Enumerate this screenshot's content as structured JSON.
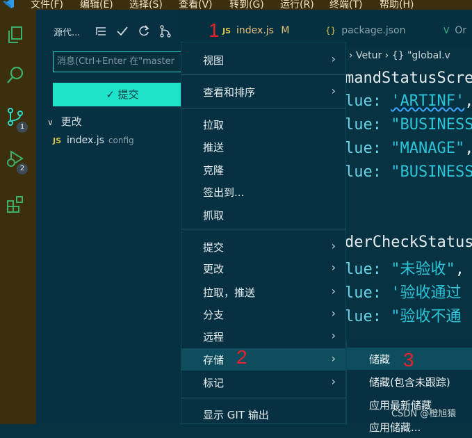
{
  "menubar": [
    "文件(F)",
    "编辑(E)",
    "选择(S)",
    "查看(V)",
    "转到(G)",
    "运行(R)",
    "终端(T)",
    "帮助(H)"
  ],
  "activity": {
    "scm_badge": "1",
    "debug_badge": "2"
  },
  "sidebar": {
    "title": "源代...",
    "more": "···",
    "message_placeholder": "消息(Ctrl+Enter 在\"master",
    "commit_label": "✓ 提交",
    "changes_label": "更改",
    "file": {
      "icon": "JS",
      "name": "index.js",
      "detail": "config"
    }
  },
  "tabs": [
    {
      "icon": "JS",
      "name": "index.js",
      "status": "M"
    },
    {
      "icon": "{}",
      "name": "package.json"
    },
    {
      "icon": "V",
      "name": "Or"
    }
  ],
  "breadcrumb": "ue › Vetur › {} \"global.v",
  "code": {
    "l1": "mandStatusScre",
    "l2k": "lue: ",
    "l2v": "'ARTINF'",
    "l2s": ",",
    "l3k": "lue: ",
    "l3v": "\"BUSINESS",
    "l4k": "lue: ",
    "l4v": "\"MANAGE\"",
    "l4s": ",",
    "l5k": "lue: ",
    "l5v": "\"BUSINESS",
    "l6": "derCheckStatus",
    "l7k": "lue: ",
    "l7v": "\"未验收\"",
    "l7s": ",",
    "l8k": "lue: ",
    "l8v": "'验收通过",
    "l9k": "lue: ",
    "l9v": "\"验收不通"
  },
  "context_menu": {
    "view": "视图",
    "sort": "查看和排序",
    "pull": "拉取",
    "push": "推送",
    "clone": "克隆",
    "checkout": "签出到...",
    "fetch": "抓取",
    "commit": "提交",
    "changes": "更改",
    "pull_push": "拉取，推送",
    "branch": "分支",
    "remote": "远程",
    "stash": "存储",
    "tags": "标记",
    "show_output": "显示 GIT 输出"
  },
  "submenu": {
    "stash": "储藏",
    "stash_untracked": "储藏(包含未跟踪)",
    "apply_latest": "应用最新储藏",
    "apply_stash": "应用储藏..."
  },
  "annotations": {
    "a1": "1",
    "a2": "2",
    "a3": "3"
  },
  "watermark": "CSDN @橙旭猿"
}
